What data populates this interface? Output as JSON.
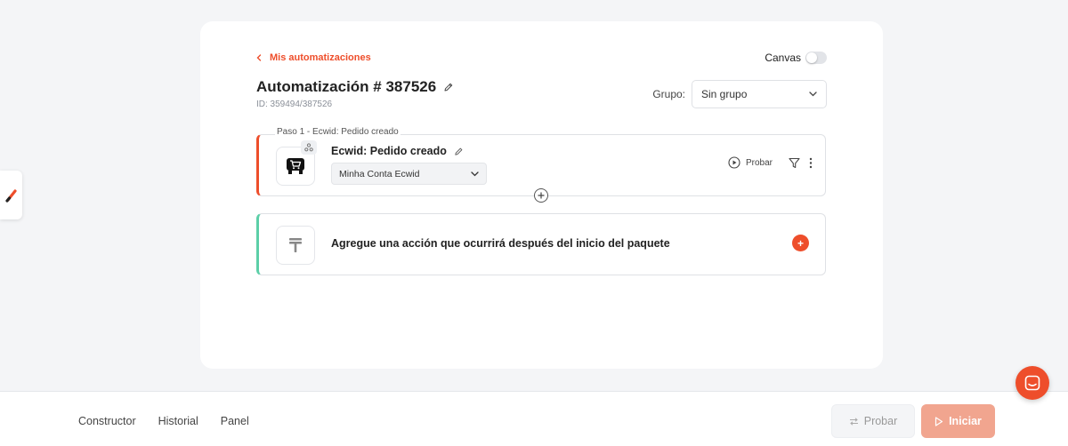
{
  "header": {
    "back_label": "Mis automatizaciones",
    "title": "Automatización # 387526",
    "id_text": "ID: 359494/387526",
    "canvas_label": "Canvas",
    "canvas_enabled": false,
    "group_label": "Grupo:",
    "group_value": "Sin grupo"
  },
  "step1": {
    "legend": "Paso 1 - Ecwid: Pedido creado",
    "title": "Ecwid: Pedido creado",
    "account": "Minha Conta Ecwid",
    "test_label": "Probar"
  },
  "action": {
    "text": "Agregue una acción que ocurrirá después del inicio del paquete"
  },
  "bottom": {
    "tabs": [
      "Constructor",
      "Historial",
      "Panel"
    ],
    "probar_label": "Probar",
    "iniciar_label": "Iniciar"
  },
  "colors": {
    "accent": "#ee4e2b",
    "action_border": "#5ccfa8",
    "iniciar_bg": "#f1a58f"
  }
}
